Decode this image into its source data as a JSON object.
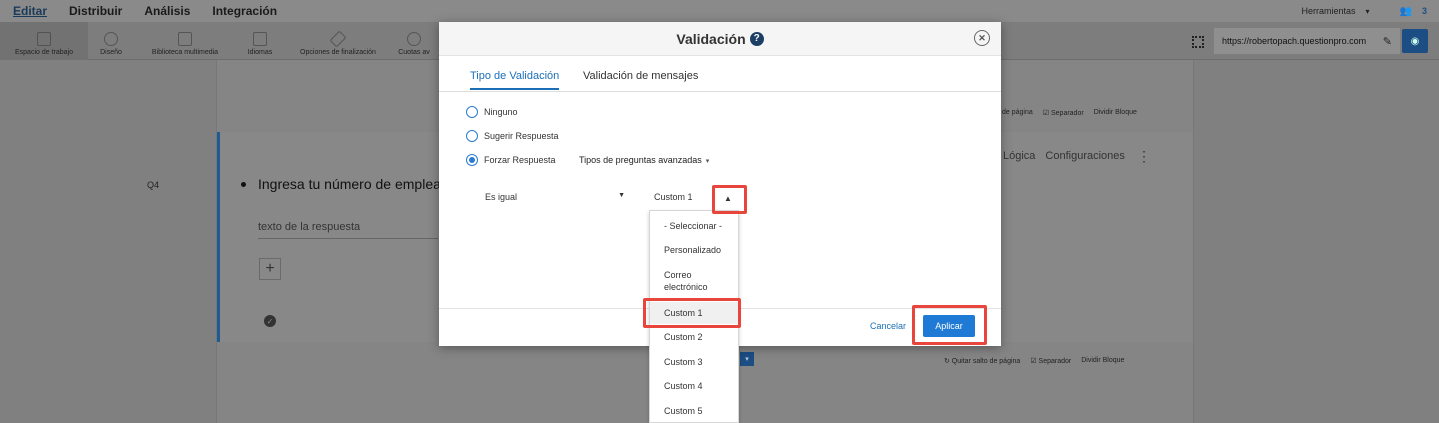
{
  "topnav": {
    "items": [
      "Editar",
      "Distribuir",
      "Análisis",
      "Integración"
    ],
    "tools_label": "Herramientas",
    "users_count": "3"
  },
  "toolbar": {
    "items": [
      "Espacio de trabajo",
      "Diseño",
      "Biblioteca multimedia",
      "Idiomas",
      "Opciones de finalización",
      "Cuotas av"
    ],
    "url": "https://robertopach.questionpro.com"
  },
  "survey": {
    "page_break_top": [
      "de página",
      "☑ Separador",
      "Dividir Bloque"
    ],
    "page_break_bottom": [
      "↻ Quitar salto de página",
      "☑ Separador",
      "Dividir Bloque"
    ],
    "question_number": "Q4",
    "question_text": "Ingresa tu número de emplea",
    "answer_placeholder": "texto de la respuesta",
    "side_tabs": [
      "Lógica",
      "Configuraciones"
    ]
  },
  "modal": {
    "title": "Validación",
    "tabs": [
      "Tipo de Validación",
      "Validación de mensajes"
    ],
    "radio_options": [
      "Ninguno",
      "Sugerir Respuesta",
      "Forzar Respuesta"
    ],
    "selected_radio": "Forzar Respuesta",
    "advanced_types": "Tipos de preguntas avanzadas",
    "comparison": "Es igual",
    "value_selected": "Custom 1",
    "cancel_label": "Cancelar",
    "apply_label": "Aplicar"
  },
  "dropdown": {
    "options": [
      "- Seleccionar -",
      "Personalizado",
      "Correo electrónico",
      "Custom 1",
      "Custom 2",
      "Custom 3",
      "Custom 4",
      "Custom 5"
    ],
    "highlighted": "Custom 1"
  },
  "colors": {
    "accent": "#1f7ad6",
    "highlight_box": "#e8453c",
    "overlay": "#808080"
  }
}
